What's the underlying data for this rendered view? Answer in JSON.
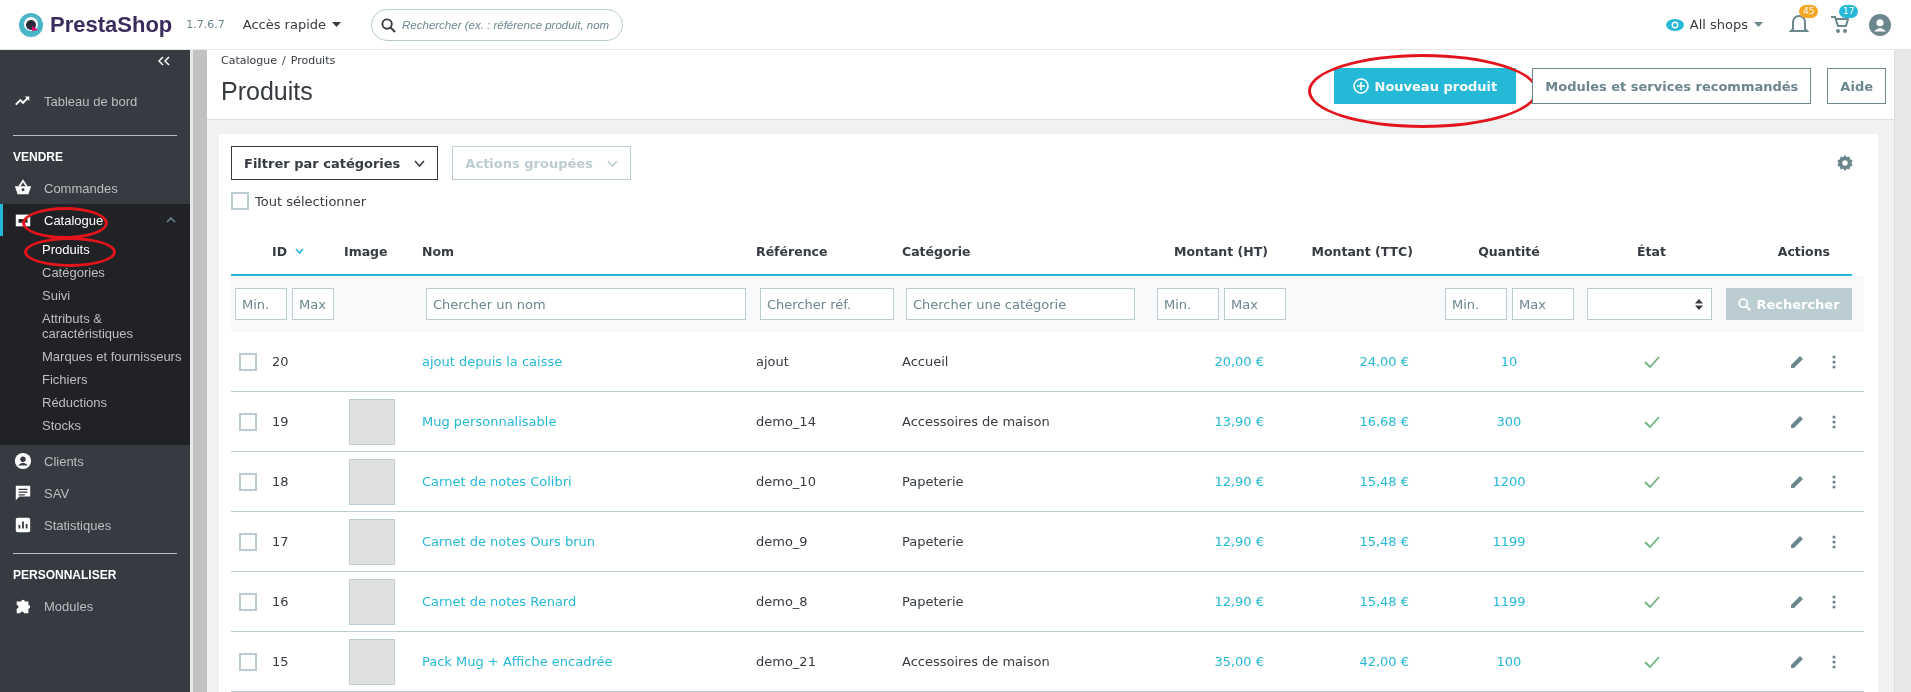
{
  "topbar": {
    "logo": "PrestaShop",
    "version": "1.7.6.7",
    "quick_access": "Accès rapide",
    "search": {
      "placeholder": "Rechercher (ex. : référence produit, nom"
    },
    "shop_selector": "All shops",
    "notifications": [
      {
        "kind": "bell",
        "count": "45",
        "color": "#f5a623"
      },
      {
        "kind": "cart",
        "count": "17",
        "color": "#25b9d7"
      }
    ]
  },
  "sidebar": {
    "items": [
      {
        "kind": "link",
        "label": "Tableau de bord",
        "selected": false
      },
      {
        "kind": "section",
        "label": "VENDRE"
      },
      {
        "kind": "link",
        "label": "Commandes",
        "selected": false
      },
      {
        "kind": "parent",
        "label": "Catalogue",
        "selected": true,
        "expanded": true,
        "circled": true,
        "children": [
          {
            "label": "Produits",
            "selected": true,
            "circled": true
          },
          {
            "label": "Catégories",
            "selected": false,
            "circled": false
          },
          {
            "label": "Suivi",
            "selected": false,
            "circled": false
          },
          {
            "label": "Attributs & caractéristiques",
            "selected": false,
            "circled": false
          },
          {
            "label": "Marques et fournisseurs",
            "selected": false,
            "circled": false
          },
          {
            "label": "Fichiers",
            "selected": false,
            "circled": false
          },
          {
            "label": "Réductions",
            "selected": false,
            "circled": false
          },
          {
            "label": "Stocks",
            "selected": false,
            "circled": false
          }
        ]
      },
      {
        "kind": "link",
        "label": "Clients",
        "selected": false
      },
      {
        "kind": "link",
        "label": "SAV",
        "selected": false
      },
      {
        "kind": "link",
        "label": "Statistiques",
        "selected": false
      },
      {
        "kind": "section",
        "label": "PERSONNALISER"
      },
      {
        "kind": "link",
        "label": "Modules",
        "selected": false
      }
    ]
  },
  "breadcrumb": {
    "items": [
      "Catalogue",
      "Produits"
    ],
    "separator": "/"
  },
  "title": "Produits",
  "header_buttons": [
    {
      "kind": "primary",
      "label": "Nouveau produit",
      "circled": true
    },
    {
      "kind": "outline",
      "label": "Modules et services recommandés",
      "circled": false
    },
    {
      "kind": "outline",
      "label": "Aide",
      "circled": false
    }
  ],
  "toolbar": {
    "category_filter": "Filtrer par catégories",
    "bulk_actions": {
      "label": "Actions groupées",
      "disabled": true
    },
    "select_all": {
      "label": "Tout sélectionner",
      "checked": false
    }
  },
  "table": {
    "columns": [
      "ID",
      "Image",
      "Nom",
      "Référence",
      "Catégorie",
      "Montant (HT)",
      "Montant (TTC)",
      "Quantité",
      "État",
      "Actions"
    ],
    "filters": {
      "id_min": {
        "placeholder": "Min."
      },
      "id_max": {
        "placeholder": "Max"
      },
      "name": {
        "placeholder": "Chercher un nom"
      },
      "reference": {
        "placeholder": "Chercher réf."
      },
      "category": {
        "placeholder": "Chercher une catégorie"
      },
      "price_min": {
        "placeholder": "Min."
      },
      "price_max": {
        "placeholder": "Max"
      },
      "qty_min": {
        "placeholder": "Min."
      },
      "qty_max": {
        "placeholder": "Max"
      },
      "search_button": "Rechercher"
    },
    "rows": [
      {
        "checked": false,
        "id": "20",
        "has_image": false,
        "name": "ajout depuis la caisse",
        "reference": "ajout",
        "category": "Accueil",
        "price_ht": "20,00 €",
        "price_ttc": "24,00 €",
        "quantity": "10",
        "active": true
      },
      {
        "checked": false,
        "id": "19",
        "has_image": true,
        "name": "Mug personnalisable",
        "reference": "demo_14",
        "category": "Accessoires de maison",
        "price_ht": "13,90 €",
        "price_ttc": "16,68 €",
        "quantity": "300",
        "active": true
      },
      {
        "checked": false,
        "id": "18",
        "has_image": true,
        "name": "Carnet de notes Colibri",
        "reference": "demo_10",
        "category": "Papeterie",
        "price_ht": "12,90 €",
        "price_ttc": "15,48 €",
        "quantity": "1200",
        "active": true
      },
      {
        "checked": false,
        "id": "17",
        "has_image": true,
        "name": "Carnet de notes Ours brun",
        "reference": "demo_9",
        "category": "Papeterie",
        "price_ht": "12,90 €",
        "price_ttc": "15,48 €",
        "quantity": "1199",
        "active": true
      },
      {
        "checked": false,
        "id": "16",
        "has_image": true,
        "name": "Carnet de notes Renard",
        "reference": "demo_8",
        "category": "Papeterie",
        "price_ht": "12,90 €",
        "price_ttc": "15,48 €",
        "quantity": "1199",
        "active": true
      },
      {
        "checked": false,
        "id": "15",
        "has_image": true,
        "name": "Pack Mug + Affiche encadrée",
        "reference": "demo_21",
        "category": "Accessoires de maison",
        "price_ht": "35,00 €",
        "price_ttc": "42,00 €",
        "quantity": "100",
        "active": true
      }
    ]
  }
}
